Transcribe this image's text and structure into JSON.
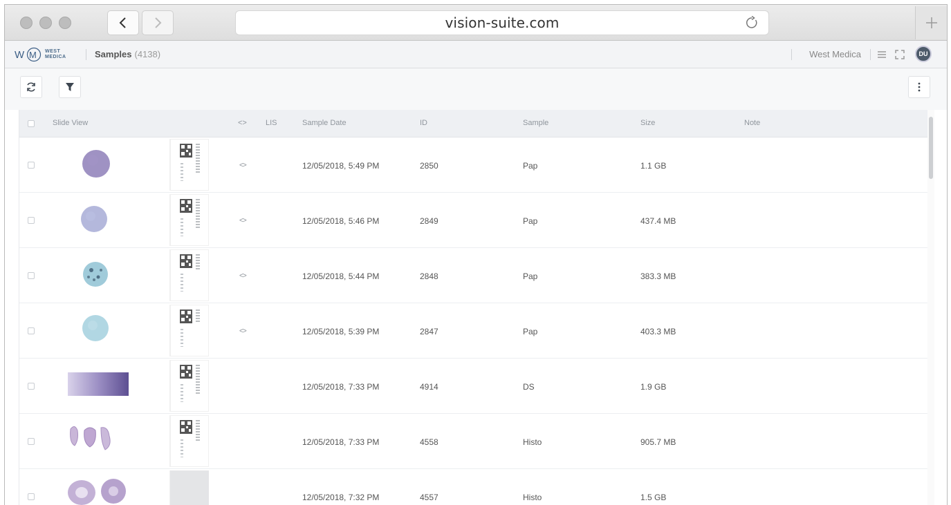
{
  "browser": {
    "url": "vision-suite.com"
  },
  "app": {
    "logo_text_line1": "WEST",
    "logo_text_line2": "MEDICA",
    "title": "Samples",
    "count": "(4138)",
    "org": "West Medica",
    "avatar": "DU"
  },
  "table": {
    "headers": {
      "slide_view": "Slide View",
      "code": "<>",
      "lis": "LIS",
      "sample_date": "Sample Date",
      "id": "ID",
      "sample": "Sample",
      "size": "Size",
      "note": "Note"
    },
    "rows": [
      {
        "code": "<>",
        "date": "12/05/2018, 5:49 PM",
        "id": "2850",
        "sample": "Pap",
        "size": "1.1 GB",
        "note": ""
      },
      {
        "code": "<>",
        "date": "12/05/2018, 5:46 PM",
        "id": "2849",
        "sample": "Pap",
        "size": "437.4 MB",
        "note": ""
      },
      {
        "code": "<>",
        "date": "12/05/2018, 5:44 PM",
        "id": "2848",
        "sample": "Pap",
        "size": "383.3 MB",
        "note": ""
      },
      {
        "code": "<>",
        "date": "12/05/2018, 5:39 PM",
        "id": "2847",
        "sample": "Pap",
        "size": "403.3 MB",
        "note": ""
      },
      {
        "code": "",
        "date": "12/05/2018, 7:33 PM",
        "id": "4914",
        "sample": "DS",
        "size": "1.9 GB",
        "note": ""
      },
      {
        "code": "",
        "date": "12/05/2018, 7:33 PM",
        "id": "4558",
        "sample": "Histo",
        "size": "905.7 MB",
        "note": ""
      },
      {
        "code": "",
        "date": "12/05/2018, 7:32 PM",
        "id": "4557",
        "sample": "Histo",
        "size": "1.5 GB",
        "note": ""
      }
    ]
  },
  "colors": {
    "pap_purple": "#8e7fb8",
    "pap_lavender": "#a7abd6",
    "pap_teal": "#8fc2d4",
    "pap_cyan": "#a9d3e0",
    "ds_purple": "#6a5a9e",
    "histo_pink": "#b9a3cf"
  }
}
